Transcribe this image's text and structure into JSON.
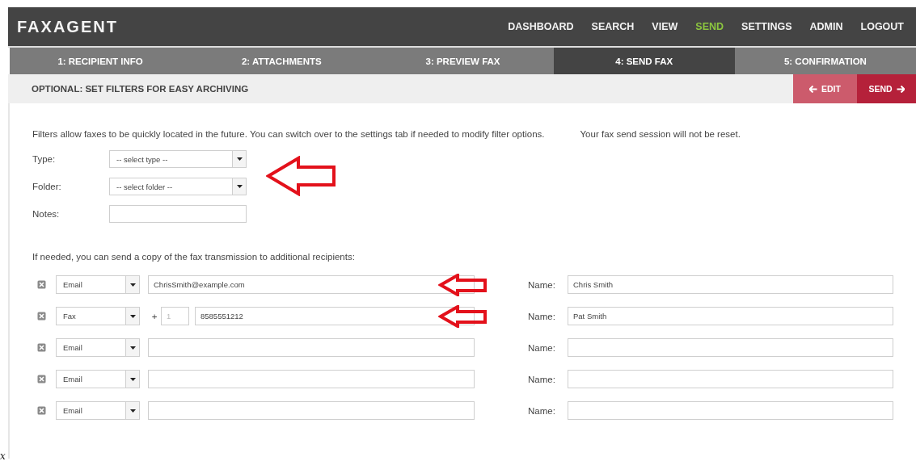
{
  "logo": "FAXAGENT",
  "nav": [
    {
      "label": "DASHBOARD",
      "selected": false
    },
    {
      "label": "SEARCH",
      "selected": false
    },
    {
      "label": "VIEW",
      "selected": false
    },
    {
      "label": "SEND",
      "selected": true
    },
    {
      "label": "SETTINGS",
      "selected": false
    },
    {
      "label": "ADMIN",
      "selected": false
    },
    {
      "label": "LOGOUT",
      "selected": false
    }
  ],
  "steps": [
    {
      "label": "1: RECIPIENT INFO",
      "selected": false
    },
    {
      "label": "2: ATTACHMENTS",
      "selected": false
    },
    {
      "label": "3: PREVIEW FAX",
      "selected": false
    },
    {
      "label": "4: SEND FAX",
      "selected": true
    },
    {
      "label": "5: CONFIRMATION",
      "selected": false
    }
  ],
  "section_title": "OPTIONAL: SET FILTERS FOR EASY ARCHIVING",
  "buttons": [
    {
      "kind": "back",
      "label": "EDIT"
    },
    {
      "kind": "next",
      "label": "SEND"
    }
  ],
  "intro": "Filters allow faxes to be quickly located in the future. You can switch over to the settings tab if needed to modify filter options.",
  "intro_note": "Your fax send session will not be reset.",
  "filters": {
    "marked": true,
    "fields": [
      {
        "kind": "select",
        "label": "Type:",
        "value": "-- select type --"
      },
      {
        "kind": "select",
        "label": "Folder:",
        "value": "-- select folder --"
      },
      {
        "kind": "text",
        "label": "Notes:"
      }
    ]
  },
  "copy_text": "If needed, you can send a copy of the fax transmission to additional recipients:",
  "recipients": [
    {
      "kind": "email",
      "method": "Email",
      "address": "ChrisSmith@example.com",
      "name_label": "Name:",
      "name": "Chris Smith",
      "marked": true
    },
    {
      "kind": "fax",
      "method": "Fax",
      "plus": "+",
      "country_placeholder": "1",
      "address": "8585551212",
      "name_label": "Name:",
      "name": "Pat Smith",
      "marked": true
    },
    {
      "kind": "email",
      "method": "Email",
      "name_label": "Name:",
      "marked": false
    },
    {
      "kind": "email",
      "method": "Email",
      "name_label": "Name:",
      "marked": false
    },
    {
      "kind": "email",
      "method": "Email",
      "name_label": "Name:",
      "marked": false
    }
  ],
  "corner_mark": "x"
}
